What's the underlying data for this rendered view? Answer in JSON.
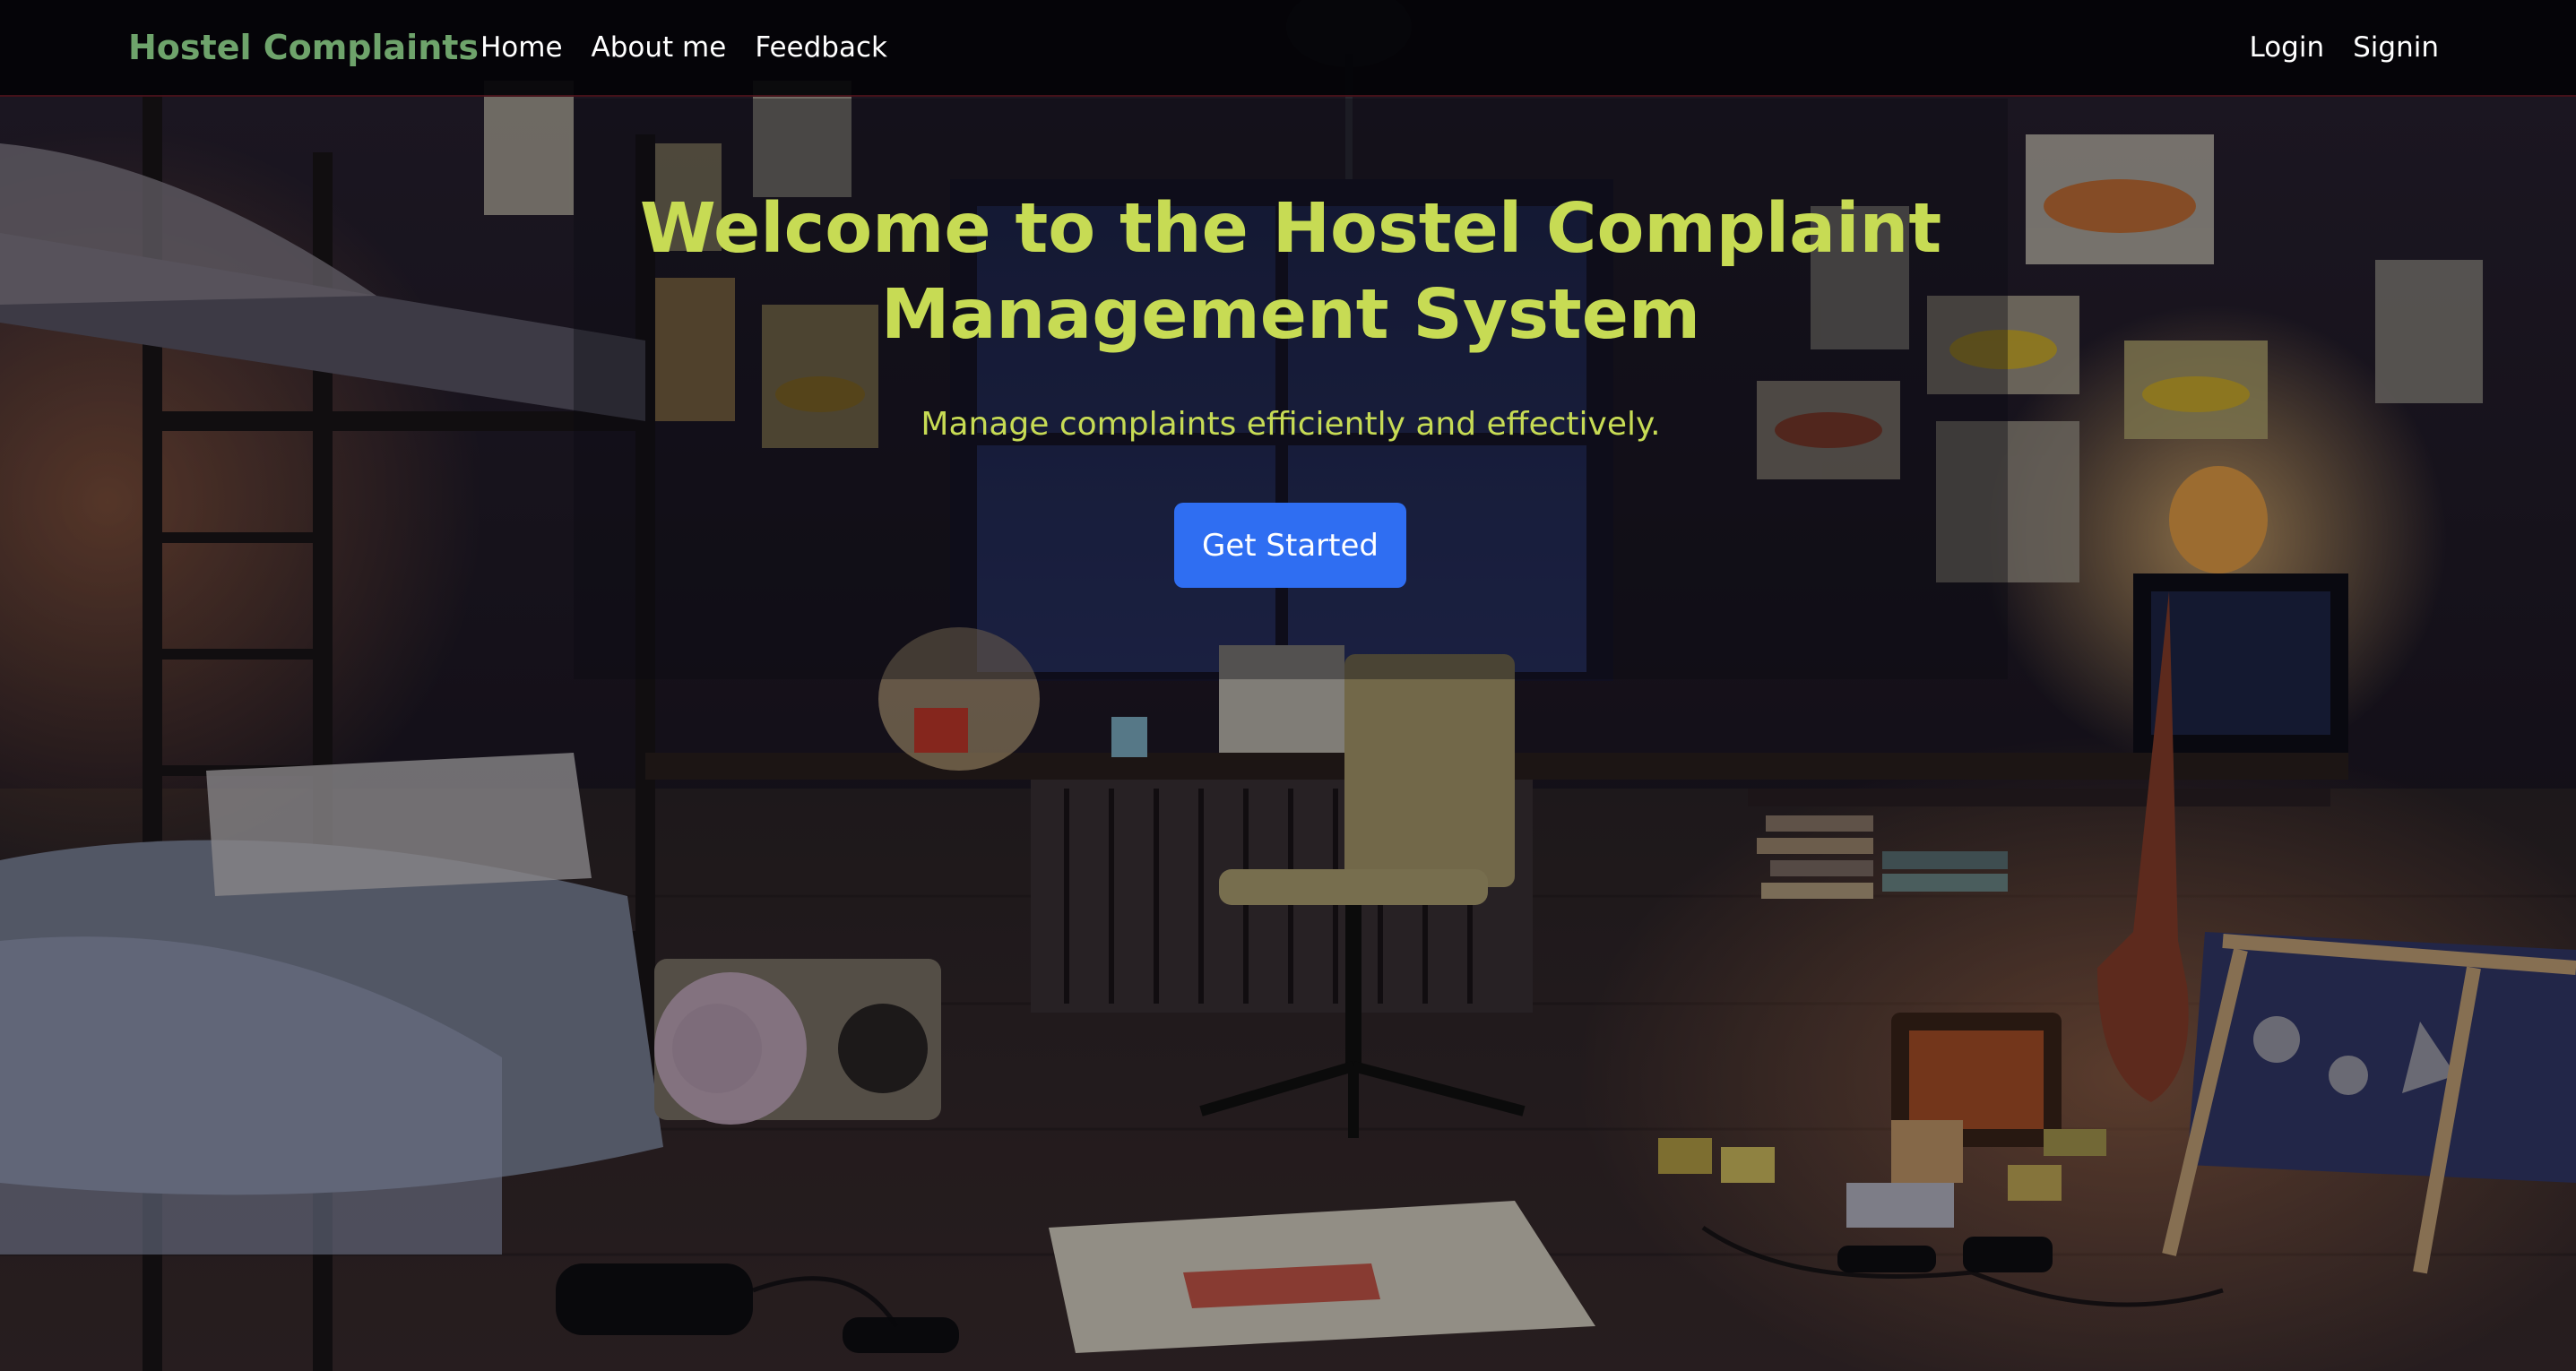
{
  "navbar": {
    "brand": "Hostel Complaints",
    "links": [
      {
        "label": "Home"
      },
      {
        "label": "About me"
      },
      {
        "label": "Feedback"
      }
    ],
    "auth": [
      {
        "label": "Login"
      },
      {
        "label": "Signin"
      }
    ]
  },
  "hero": {
    "title": "Welcome to the Hostel Complaint Management System",
    "subtitle": "Manage complaints efficiently and effectively.",
    "cta_label": "Get Started"
  },
  "colors": {
    "brand": "#6ea36b",
    "hero_text": "#c7db54",
    "cta": "#2f6ef2",
    "navbar_bg": "#040406"
  },
  "background": {
    "icon": "dorm-room-illustration"
  }
}
